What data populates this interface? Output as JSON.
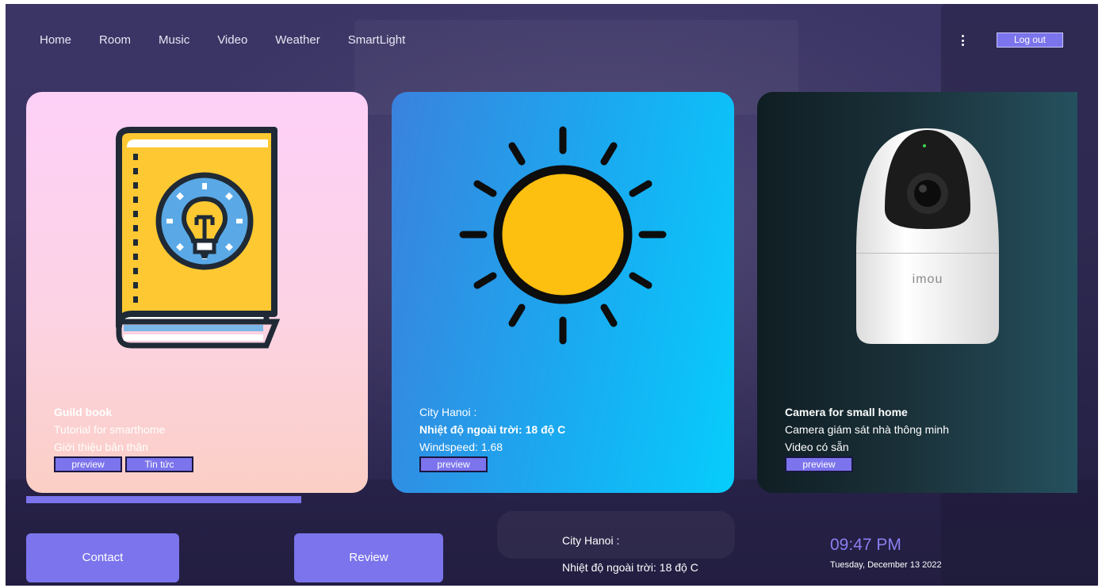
{
  "nav": {
    "items": [
      "Home",
      "Room",
      "Music",
      "Video",
      "Weather",
      "SmartLight"
    ],
    "logout_label": "Log out"
  },
  "cards": [
    {
      "title": "Guild book",
      "line1": "Tutorial for smarthome",
      "line2": "Giới thiệu bản thân",
      "buttons": [
        "preview",
        "Tin tức"
      ]
    },
    {
      "title": "City Hanoi :",
      "line1": "Nhiệt độ ngoài trời: 18 độ C",
      "line2": "Windspeed: 1.68",
      "buttons": [
        "preview"
      ]
    },
    {
      "title": "Camera for small home",
      "line1": "Camera giám sát nhà thông minh",
      "line2": "Video có sẵn",
      "buttons": [
        "preview"
      ],
      "brand": "imou"
    }
  ],
  "footer": {
    "contact_label": "Contact",
    "review_label": "Review",
    "weather_city": "City Hanoi :",
    "weather_temp": "Nhiệt độ ngoài trời: 18 độ C",
    "time": "09:47 PM",
    "date": "Tuesday, December 13 2022"
  },
  "icons": {
    "card1": "book-lightbulb-icon",
    "card2": "sun-icon",
    "card3": "security-camera-image",
    "menu": "more-vertical-icon"
  },
  "colors": {
    "accent": "#7b74ec",
    "sun": "#fdbf10",
    "book": "#fdc832"
  }
}
